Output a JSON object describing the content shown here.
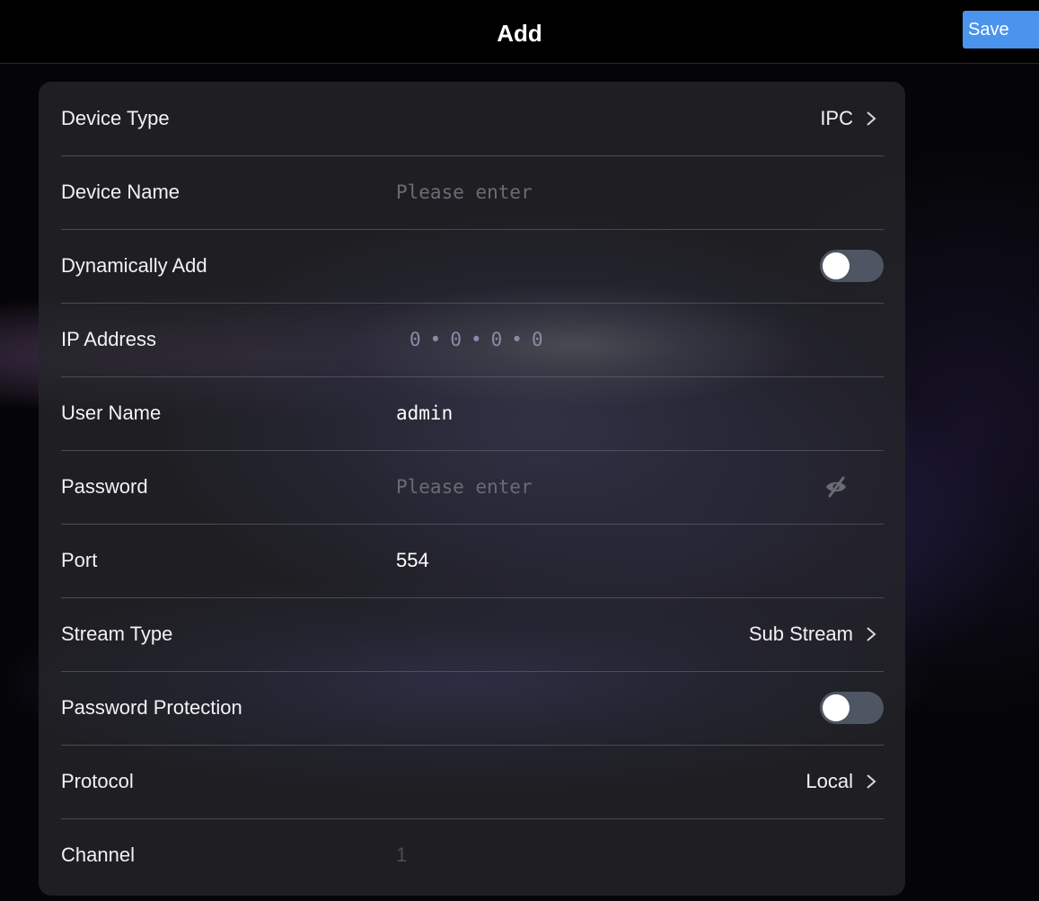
{
  "header": {
    "title": "Add",
    "save_label": "Save"
  },
  "form": {
    "device_type": {
      "label": "Device Type",
      "value": "IPC"
    },
    "device_name": {
      "label": "Device Name",
      "placeholder": "Please enter"
    },
    "dynamically_add": {
      "label": "Dynamically Add",
      "enabled": false
    },
    "ip_address": {
      "label": "IP Address",
      "octets": [
        "0",
        "0",
        "0",
        "0"
      ]
    },
    "user_name": {
      "label": "User Name",
      "value": "admin"
    },
    "password": {
      "label": "Password",
      "placeholder": "Please enter",
      "visibility_icon": "eye-slash-icon"
    },
    "port": {
      "label": "Port",
      "value": "554"
    },
    "stream_type": {
      "label": "Stream Type",
      "value": "Sub Stream"
    },
    "password_protection": {
      "label": "Password Protection",
      "enabled": false
    },
    "protocol": {
      "label": "Protocol",
      "value": "Local"
    },
    "channel": {
      "label": "Channel",
      "value": "1"
    }
  },
  "colors": {
    "accent": "#4a94ee",
    "panel": "#26262a",
    "toggle_off": "#4e5663"
  }
}
